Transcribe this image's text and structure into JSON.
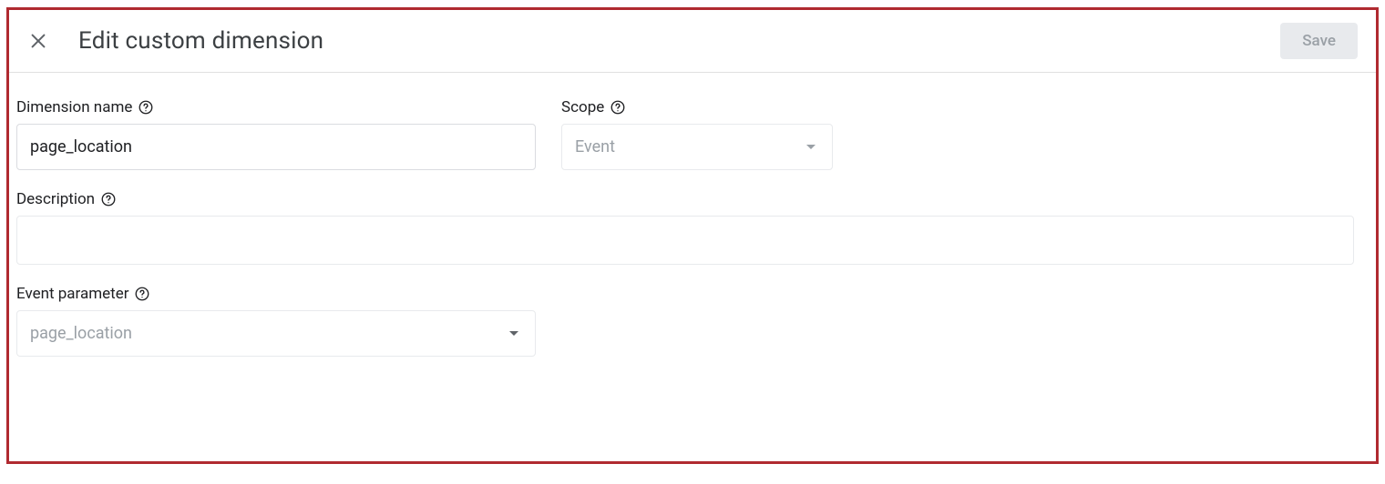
{
  "header": {
    "title": "Edit custom dimension",
    "save_label": "Save"
  },
  "fields": {
    "dimension_name": {
      "label": "Dimension name",
      "value": "page_location"
    },
    "scope": {
      "label": "Scope",
      "value": "Event"
    },
    "description": {
      "label": "Description",
      "value": ""
    },
    "event_parameter": {
      "label": "Event parameter",
      "value": "page_location"
    }
  }
}
